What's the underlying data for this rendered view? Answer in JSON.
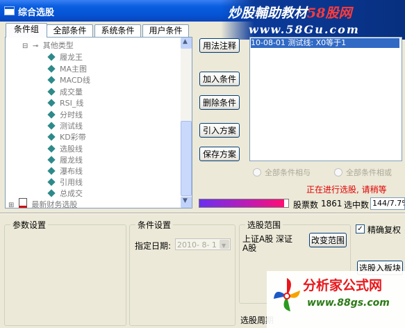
{
  "window": {
    "title": "综合选股"
  },
  "watermark_top": {
    "line1_prefix": "炒股輔助教材",
    "line1_brand": "58股网",
    "line2": "www.58Gu.com"
  },
  "tabs": [
    {
      "label": "条件组",
      "active": true
    },
    {
      "label": "全部条件",
      "active": false
    },
    {
      "label": "系统条件",
      "active": false
    },
    {
      "label": "用户条件",
      "active": false
    }
  ],
  "tree": {
    "parent": {
      "toggle": "⊟",
      "label": "其他类型"
    },
    "items": [
      "履龙王",
      "MA主图",
      "MACD线",
      "成交量",
      "RSI_线",
      "分时线",
      "测试线",
      "KD彩带",
      "选股线",
      "履龙线",
      "瀑布线",
      "引用线",
      "总成交"
    ],
    "bottom": {
      "toggle": "⊞",
      "label": "最新财务选股"
    }
  },
  "buttons": {
    "usage": "用法注释",
    "add_condition": "加入条件",
    "delete_condition": "删除条件",
    "import_plan": "引入方案",
    "save_plan": "保存方案",
    "change_range": "改变范围",
    "select_into_block": "选股入板块"
  },
  "condition_list": {
    "selected_item": "10-08-01 测试线: X0等于1"
  },
  "radios": {
    "all_and": "全部条件相与",
    "all_or": "全部条件相或"
  },
  "status": {
    "text": "正在进行选股, 请稍等"
  },
  "progress": {
    "fraction": 0.95,
    "color_start": "#6a2ff0",
    "color_end": "#ff0f73"
  },
  "stats": {
    "total_label": "股票数",
    "total_value": "1861",
    "selected_label": "选中数",
    "selected_value": "144/7.7%"
  },
  "params": {
    "title": "参数设置"
  },
  "condition_settings": {
    "title": "条件设置",
    "date_label": "指定日期:",
    "date_value": "2010- 8- 1"
  },
  "range": {
    "title": "选股范围",
    "value": "上证A股 深证A股"
  },
  "options": {
    "precise_restore_label": "精确复权",
    "precise_restore_checked": true
  },
  "period": {
    "label": "选股周期"
  },
  "watermark_bottom": {
    "site": "分析家公式网",
    "url": "www.88gs.com"
  }
}
